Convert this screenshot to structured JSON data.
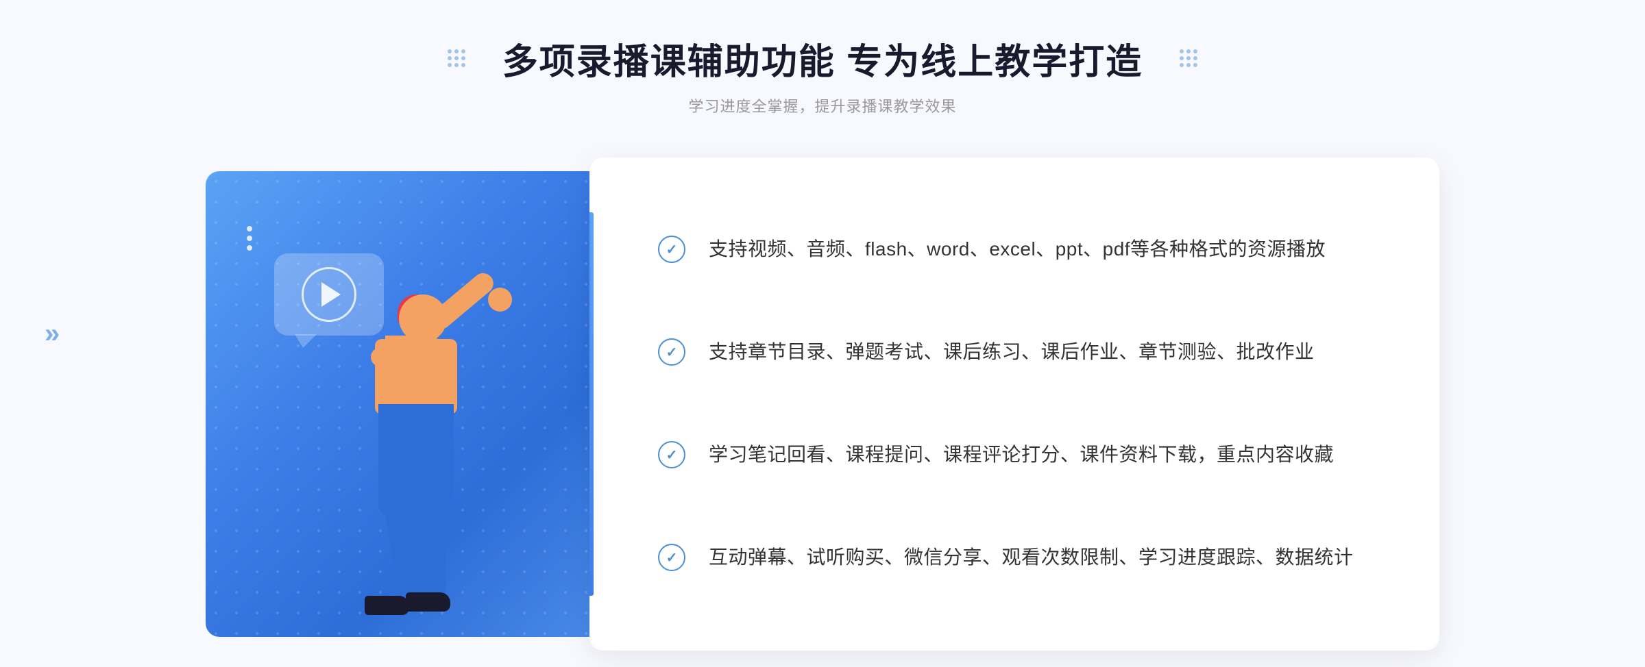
{
  "page": {
    "background": "#f8f9ff"
  },
  "header": {
    "title": "多项录播课辅助功能 专为线上教学打造",
    "subtitle": "学习进度全掌握，提升录播课教学效果",
    "dots_label": "decorative-dots"
  },
  "features": [
    {
      "id": 1,
      "text": "支持视频、音频、flash、word、excel、ppt、pdf等各种格式的资源播放"
    },
    {
      "id": 2,
      "text": "支持章节目录、弹题考试、课后练习、课后作业、章节测验、批改作业"
    },
    {
      "id": 3,
      "text": "学习笔记回看、课程提问、课程评论打分、课件资料下载，重点内容收藏"
    },
    {
      "id": 4,
      "text": "互动弹幕、试听购买、微信分享、观看次数限制、学习进度跟踪、数据统计"
    }
  ],
  "illustration": {
    "play_button_label": "play-button",
    "character_label": "teaching-character"
  },
  "navigation": {
    "left_arrow": "«",
    "right_arrow": "»"
  }
}
